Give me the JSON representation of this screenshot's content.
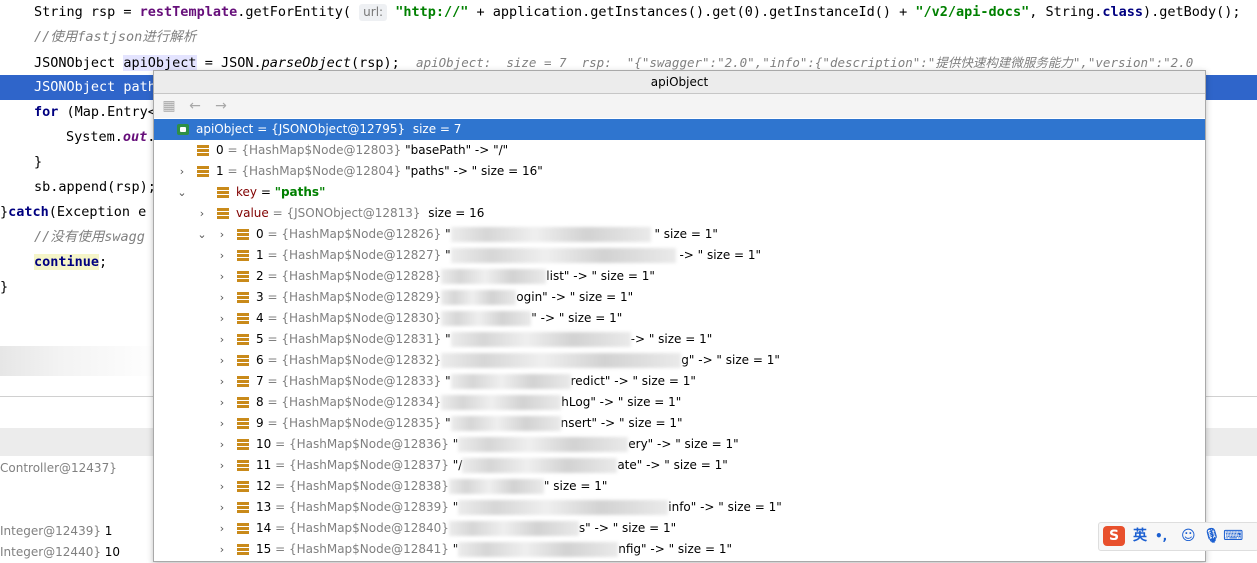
{
  "editor": {
    "line1": {
      "a": "String rsp = ",
      "field": "restTemplate",
      "b": ".getForEntity(",
      "hint": "url:",
      "s1": "\"http://\"",
      "c": " + application.getInstances().get(0).getInstanceId() + ",
      "s2": "\"/v2/api-docs\"",
      "d": ", String.",
      "kw": "class",
      "e": ").getBody();"
    },
    "line2": {
      "comment": "//使用fastjson进行解析"
    },
    "line3": {
      "a": "JSONObject ",
      "sel": "apiObject",
      "b": " = JSON.",
      "m": "parseObject",
      "c": "(rsp);",
      "inline": "apiObject:  size = 7  rsp:  \"{\"swagger\":\"2.0\",\"info\":{\"description\":\"提供快速构建微服务能力\",\"version\":\"2.0"
    },
    "line4": {
      "text": "JSONObject path"
    },
    "line5": {
      "kw": "for",
      "a": " (Map.Entry<"
    },
    "line6": {
      "a": "System.",
      "fld": "out",
      "b": "."
    },
    "line7": {
      "text": "}"
    },
    "line8": {
      "text": "sb.append(rsp);"
    },
    "line9": {
      "a": "}",
      "kw": "catch",
      "b": "(Exception e"
    },
    "line10": {
      "comment": "//没有使用swagg"
    },
    "line11": {
      "kw": "continue",
      "b": ";"
    },
    "line12": {
      "text": "}"
    }
  },
  "panel": {
    "rows": [
      {
        "name": "Controller@12437}",
        "value": ""
      },
      {
        "name": "Integer@12439}",
        "value": " 1"
      },
      {
        "name": "Integer@12440}",
        "value": " 10"
      }
    ]
  },
  "popup": {
    "title": "apiObject",
    "root": {
      "name": "apiObject",
      "type": " = {JSONObject@12795}",
      "size": "  size = 7"
    },
    "entry0": {
      "idx": "0",
      "type": " = {HashMap$Node@12803}",
      "val": " \"basePath\" -> \"/\""
    },
    "entry1": {
      "idx": "1",
      "type": " = {HashMap$Node@12804}",
      "val": " \"paths\" -> \" size = 16\""
    },
    "key": {
      "label": "key",
      "eq": " = ",
      "val": "\"paths\""
    },
    "value": {
      "label": "value",
      "type": " = {JSONObject@12813}",
      "size": "  size = 16"
    },
    "children": [
      {
        "idx": "0",
        "type": " = {HashMap$Node@12826}",
        "lead": " \"",
        "tail": " \" size = 1\""
      },
      {
        "idx": "1",
        "type": " = {HashMap$Node@12827}",
        "lead": " \"",
        "tail": " -> \" size = 1\""
      },
      {
        "idx": "2",
        "type": " = {HashMap$Node@12828}",
        "lead": "",
        "tail": "list\" -> \" size = 1\""
      },
      {
        "idx": "3",
        "type": " = {HashMap$Node@12829}",
        "lead": "",
        "tail": "ogin\" -> \" size = 1\""
      },
      {
        "idx": "4",
        "type": " = {HashMap$Node@12830}",
        "lead": "",
        "tail": "\" -> \" size = 1\""
      },
      {
        "idx": "5",
        "type": " = {HashMap$Node@12831}",
        "lead": " \"",
        "tail": "-> \" size = 1\""
      },
      {
        "idx": "6",
        "type": " = {HashMap$Node@12832}",
        "lead": "",
        "tail": "g\" -> \" size = 1\""
      },
      {
        "idx": "7",
        "type": " = {HashMap$Node@12833}",
        "lead": " \"",
        "tail": "redict\" -> \" size = 1\""
      },
      {
        "idx": "8",
        "type": " = {HashMap$Node@12834}",
        "lead": "",
        "tail": "hLog\" -> \" size = 1\""
      },
      {
        "idx": "9",
        "type": " = {HashMap$Node@12835}",
        "lead": " \"",
        "tail": "nsert\" -> \" size = 1\""
      },
      {
        "idx": "10",
        "type": " = {HashMap$Node@12836}",
        "lead": " \"",
        "tail": "ery\" -> \" size = 1\""
      },
      {
        "idx": "11",
        "type": " = {HashMap$Node@12837}",
        "lead": " \"/",
        "tail": "ate\" -> \" size = 1\""
      },
      {
        "idx": "12",
        "type": " = {HashMap$Node@12838}",
        "lead": "",
        "tail": "\" size = 1\""
      },
      {
        "idx": "13",
        "type": " = {HashMap$Node@12839}",
        "lead": " \"",
        "tail": "info\" -> \" size = 1\""
      },
      {
        "idx": "14",
        "type": " = {HashMap$Node@12840}",
        "lead": "",
        "tail": "s\" -> \" size = 1\""
      },
      {
        "idx": "15",
        "type": " = {HashMap$Node@12841}",
        "lead": " \"",
        "tail": "nfig\" -> \" size = 1\""
      }
    ]
  },
  "ime": {
    "logo": "S",
    "mode": "英",
    "punct": "•,"
  },
  "icons": {
    "back": "arrow-left-icon",
    "forward": "arrow-right-icon",
    "expand": "chevron-right-icon",
    "collapse": "chevron-down-icon"
  }
}
